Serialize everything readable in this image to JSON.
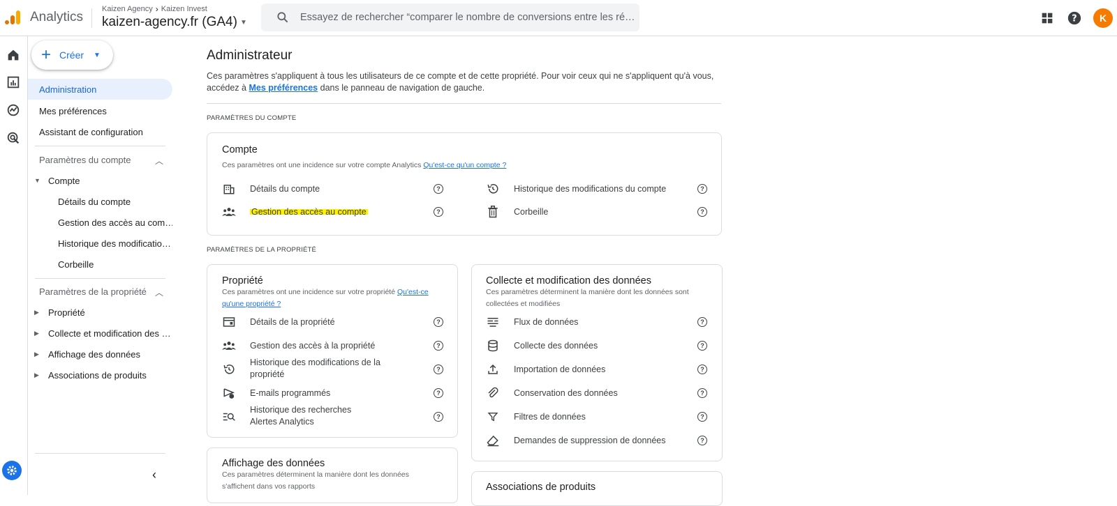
{
  "colors": {
    "accent": "#1a73e8",
    "highlight": "#fff200",
    "avatar": "#f57c00"
  },
  "header": {
    "app_name": "Analytics",
    "breadcrumb": [
      "Kaizen Agency",
      "Kaizen Invest"
    ],
    "property": "kaizen-agency.fr (GA4)",
    "search_placeholder": "Essayez de rechercher “comparer le nombre de conversions entre les rés…"
  },
  "sidebar": {
    "create_label": "Créer",
    "nav": [
      "Administration",
      "Mes préférences",
      "Assistant de configuration"
    ],
    "account_section": "Paramètres du compte",
    "account_group": "Compte",
    "account_items": [
      "Détails du compte",
      "Gestion des accès au com…",
      "Historique des modificatio…",
      "Corbeille"
    ],
    "property_section": "Paramètres de la propriété",
    "property_items": [
      "Propriété",
      "Collecte et modification des …",
      "Affichage des données",
      "Associations de produits"
    ]
  },
  "main": {
    "title": "Administrateur",
    "desc_prefix": "Ces paramètres s'appliquent à tous les utilisateurs de ce compte et de cette propriété. Pour voir ceux qui ne s'appliquent qu'à vous, accédez à ",
    "desc_link": "Mes préférences",
    "desc_suffix": " dans le panneau de navigation de gauche.",
    "account_label": "PARAMÈTRES DU COMPTE",
    "property_label": "PARAMÈTRES DE LA PROPRIÉTÉ",
    "account_card": {
      "title": "Compte",
      "sub": "Ces paramètres ont une incidence sur votre compte Analytics ",
      "sub_link": "Qu'est-ce qu'un compte ?",
      "left": [
        "Détails du compte",
        "Gestion des accès au compte"
      ],
      "right": [
        "Historique des modifications du compte",
        "Corbeille"
      ]
    },
    "property_card": {
      "title": "Propriété",
      "sub": "Ces paramètres ont une incidence sur votre propriété ",
      "sub_link": "Qu'est-ce qu'une propriété ?",
      "items": [
        "Détails de la propriété",
        "Gestion des accès à la propriété",
        "Historique des modifications de la propriété",
        "E-mails programmés",
        "Historique des recherches\nAlertes Analytics"
      ]
    },
    "data_card": {
      "title": "Collecte et modification des données",
      "sub": "Ces paramètres déterminent la manière dont les données sont collectées et modifiées",
      "items": [
        "Flux de données",
        "Collecte des données",
        "Importation de données",
        "Conservation des données",
        "Filtres de données",
        "Demandes de suppression de données"
      ]
    },
    "display_card": {
      "title": "Affichage des données",
      "sub": "Ces paramètres déterminent la manière dont les données s'affichent dans vos rapports"
    },
    "assoc_card": {
      "title": "Associations de produits"
    }
  }
}
